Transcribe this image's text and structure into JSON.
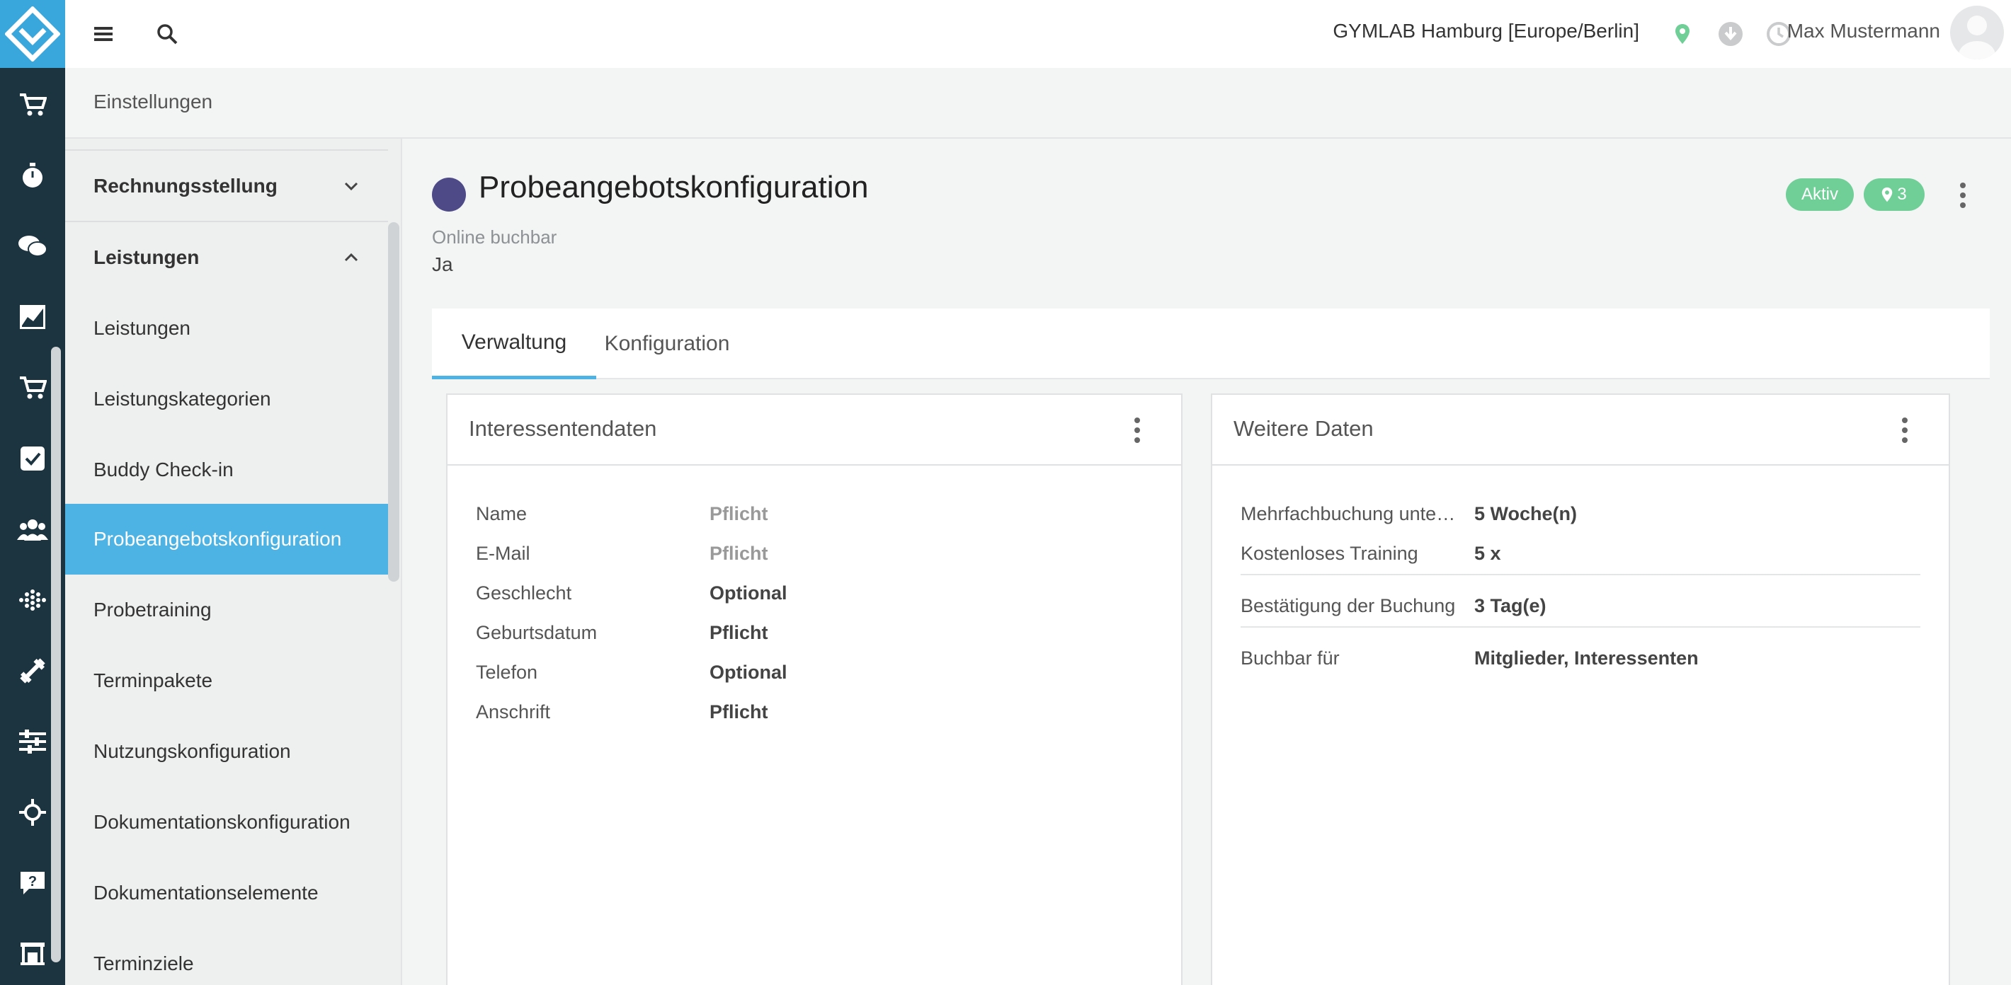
{
  "topbar": {
    "location": "GYMLAB Hamburg [Europe/Berlin]",
    "user": "Max Mustermann"
  },
  "breadcrumb": "Einstellungen",
  "sidebar": {
    "items": [
      {
        "label": "Rechnungsstellung",
        "type": "group",
        "expanded": false
      },
      {
        "label": "Leistungen",
        "type": "group",
        "expanded": true
      },
      {
        "label": "Leistungen",
        "type": "item"
      },
      {
        "label": "Leistungskategorien",
        "type": "item"
      },
      {
        "label": "Buddy Check-in",
        "type": "item"
      },
      {
        "label": "Probeangebotskonfiguration",
        "type": "item",
        "active": true
      },
      {
        "label": "Probetraining",
        "type": "item"
      },
      {
        "label": "Terminpakete",
        "type": "item"
      },
      {
        "label": "Nutzungskonfiguration",
        "type": "item"
      },
      {
        "label": "Dokumentationskonfiguration",
        "type": "item"
      },
      {
        "label": "Dokumentationselemente",
        "type": "item"
      },
      {
        "label": "Terminziele",
        "type": "item"
      }
    ]
  },
  "page": {
    "title": "Probeangebotskonfiguration",
    "meta_label": "Online buchbar",
    "meta_value": "Ja",
    "status_badge": "Aktiv",
    "location_count": "3",
    "accent_color": "#4cb3e4",
    "dot_color": "#4d4a87"
  },
  "tabs": [
    {
      "label": "Verwaltung",
      "active": true
    },
    {
      "label": "Konfiguration",
      "active": false
    }
  ],
  "panels": {
    "interessenten": {
      "title": "Interessentendaten",
      "rows": [
        {
          "key": "Name",
          "value": "Pflicht",
          "muted": true
        },
        {
          "key": "E-Mail",
          "value": "Pflicht",
          "muted": true
        },
        {
          "key": "Geschlecht",
          "value": "Optional"
        },
        {
          "key": "Geburtsdatum",
          "value": "Pflicht"
        },
        {
          "key": "Telefon",
          "value": "Optional"
        },
        {
          "key": "Anschrift",
          "value": "Pflicht"
        }
      ]
    },
    "weitere": {
      "title": "Weitere Daten",
      "rows": [
        {
          "key": "Mehrfachbuchung unte…",
          "value": "5 Woche(n)"
        },
        {
          "key": "Kostenloses Training",
          "value": "5 x"
        },
        {
          "key": "Bestätigung der Buchung",
          "value": "3 Tag(e)"
        },
        {
          "key": "Buchbar für",
          "value": "Mitglieder, Interessenten"
        }
      ]
    }
  }
}
